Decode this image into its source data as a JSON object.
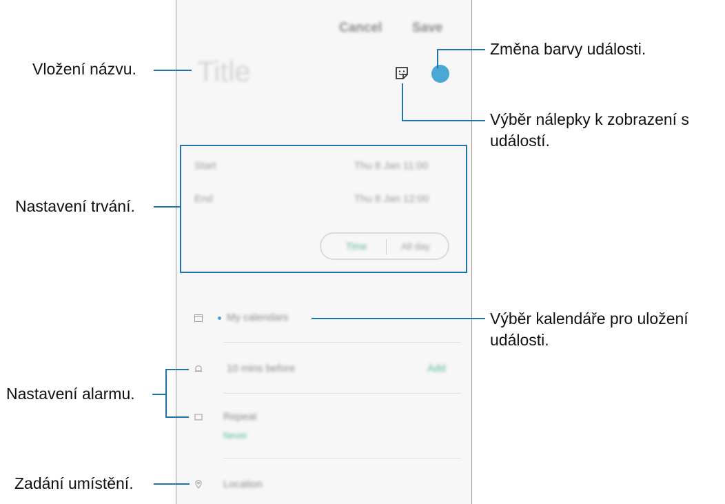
{
  "header": {
    "cancel_label": "Cancel",
    "save_label": "Save"
  },
  "title_field": {
    "placeholder": "Title"
  },
  "duration": {
    "start_label": "Start",
    "start_value": "Thu 8 Jan 11:00",
    "end_label": "End",
    "end_value": "Thu 8 Jan 12:00",
    "toggle": {
      "time_label": "Time",
      "allday_label": "All day"
    }
  },
  "calendar": {
    "label": "My calendars"
  },
  "alarm": {
    "label": "10 mins before",
    "add_label": "Add"
  },
  "repeat": {
    "label": "Repeat",
    "value": "Never"
  },
  "location": {
    "placeholder": "Location"
  },
  "colors": {
    "accent": "#4aa8d4",
    "callout_line": "#1f73a8",
    "teal": "#5ab7a0"
  },
  "annotations": {
    "title": "Vložení názvu.",
    "color": "Změna barvy události.",
    "sticker": "Výběr nálepky k zobrazení s událostí.",
    "duration": "Nastavení trvání.",
    "calendar": "Výběr kalendáře pro uložení události.",
    "alarm": "Nastavení alarmu.",
    "location": "Zadání umístění."
  }
}
